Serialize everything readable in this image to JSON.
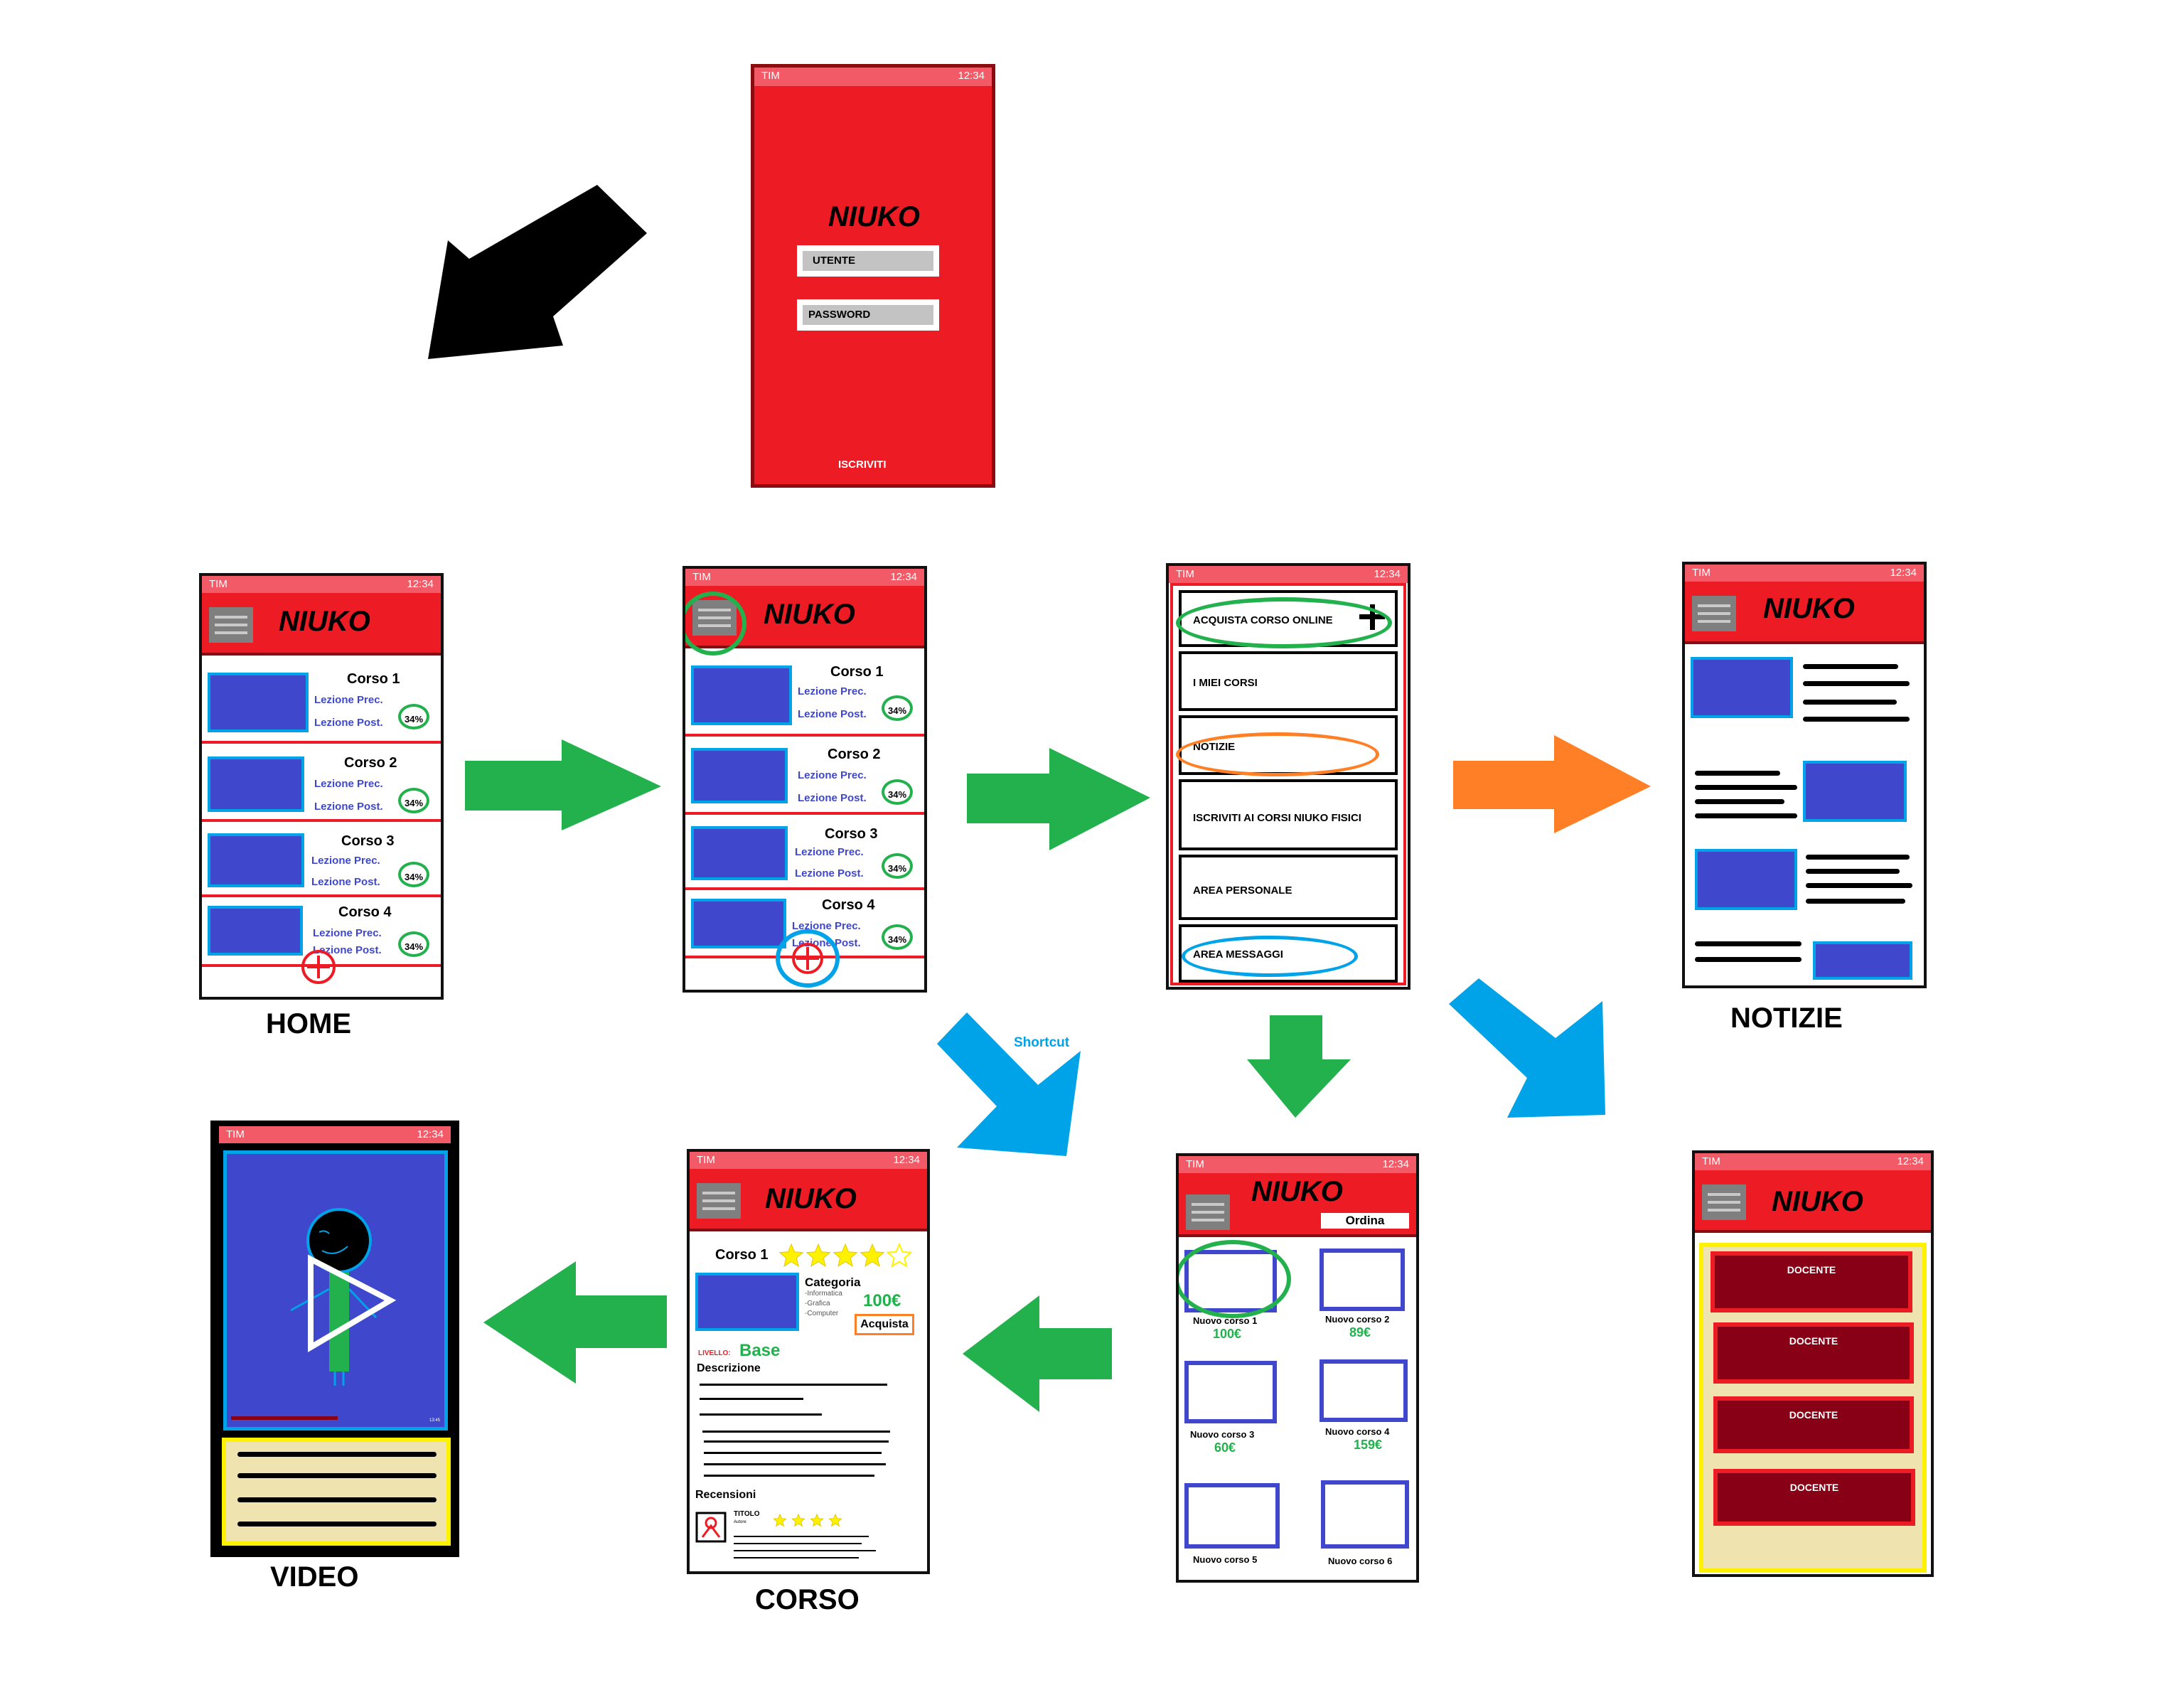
{
  "status": {
    "carrier": "TIM",
    "time": "12:34"
  },
  "app_name": "NIUKO",
  "login": {
    "user_field": "UTENTE",
    "password_field": "PASSWORD",
    "signup": "ISCRIVITI"
  },
  "courses": [
    {
      "title": "Corso 1",
      "prev": "Lezione Prec.",
      "next": "Lezione Post.",
      "progress": "34%"
    },
    {
      "title": "Corso 2",
      "prev": "Lezione Prec.",
      "next": "Lezione Post.",
      "progress": "34%"
    },
    {
      "title": "Corso 3",
      "prev": "Lezione Prec.",
      "next": "Lezione Post.",
      "progress": "34%"
    },
    {
      "title": "Corso 4",
      "prev": "Lezione Prec.",
      "next": "Lezione Post.",
      "progress": "34%"
    }
  ],
  "menu": {
    "items": [
      "ACQUISTA CORSO ONLINE",
      "I MIEI CORSI",
      "NOTIZIE",
      "ISCRIVITI AI CORSI NIUKO FISICI",
      "AREA PERSONALE",
      "AREA MESSAGGI"
    ]
  },
  "labels": {
    "home": "HOME",
    "notizie": "NOTIZIE",
    "video": "VIDEO",
    "corso": "CORSO",
    "shortcut": "Shortcut"
  },
  "catalog": {
    "sort": "Ordina",
    "items": [
      {
        "name": "Nuovo corso 1",
        "price": "100€"
      },
      {
        "name": "Nuovo corso 2",
        "price": "89€"
      },
      {
        "name": "Nuovo corso 3",
        "price": "60€"
      },
      {
        "name": "Nuovo corso 4",
        "price": "159€"
      },
      {
        "name": "Nuovo corso 5",
        "price": ""
      },
      {
        "name": "Nuovo corso 6",
        "price": ""
      }
    ]
  },
  "course_detail": {
    "title": "Corso 1",
    "rating": 4,
    "category_label": "Categoria",
    "categories": [
      "-Informatica",
      "-Grafica",
      "-Computer"
    ],
    "price": "100€",
    "buy": "Acquista",
    "level_label": "LIVELLO:",
    "level": "Base",
    "description_label": "Descrizione",
    "reviews_label": "Recensioni",
    "review_title": "TITOLO",
    "review_meta": "Autore"
  },
  "video": {
    "duration": "13:45"
  },
  "teachers": {
    "items": [
      "DOCENTE",
      "DOCENTE",
      "DOCENTE",
      "DOCENTE"
    ]
  },
  "colors": {
    "green": "#22b14c",
    "blue": "#00a2e8",
    "orange": "#ff7f27",
    "red": "#ed1c24",
    "navy": "#3f48cc"
  }
}
